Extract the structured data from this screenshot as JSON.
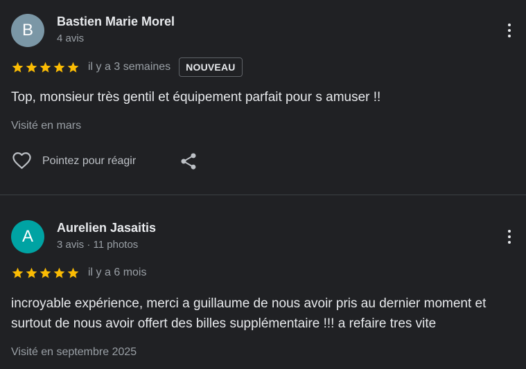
{
  "colors": {
    "background": "#202124",
    "star": "#fbbc04",
    "avatar_b": "#7b97a6",
    "avatar_a": "#00a3a3"
  },
  "reviews": [
    {
      "avatar_letter": "B",
      "name": "Bastien Marie Morel",
      "meta": "4 avis",
      "stars": 5,
      "when": "il y a 3 semaines",
      "badge": "NOUVEAU",
      "text": "Top, monsieur très gentil et équipement parfait pour s amuser !!",
      "visited": "Visité en mars",
      "react_label": "Pointez pour réagir",
      "icons": {
        "more": "more-vert-icon",
        "react": "heart-icon",
        "share": "share-icon"
      }
    },
    {
      "avatar_letter": "A",
      "name": "Aurelien Jasaitis",
      "meta": "3 avis · 11 photos",
      "stars": 5,
      "when": "il y a 6 mois",
      "text": "incroyable expérience, merci a guillaume de nous avoir pris au dernier moment et surtout de nous avoir offert des billes supplémentaire !!! a refaire tres vite",
      "visited": "Visité en septembre 2025",
      "icons": {
        "more": "more-vert-icon"
      }
    }
  ]
}
